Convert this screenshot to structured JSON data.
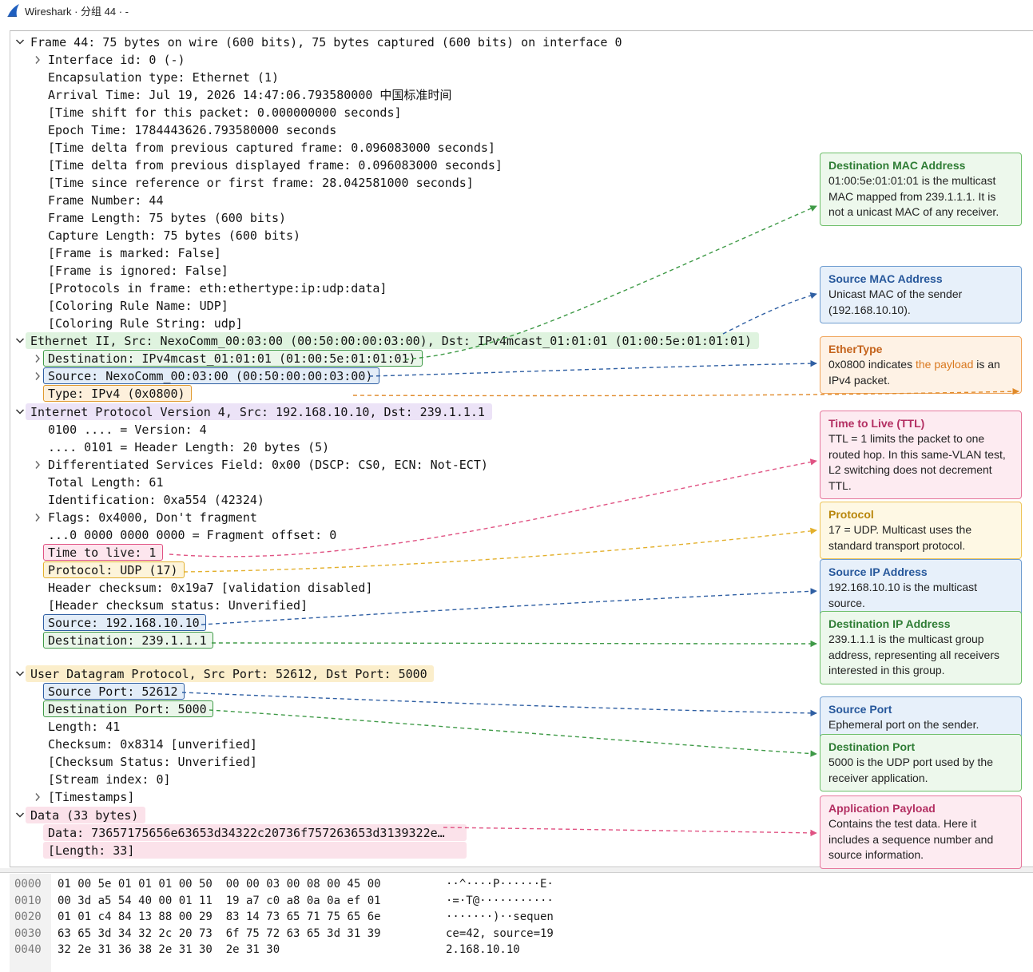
{
  "window": {
    "title": "Wireshark · 分组 44 · -",
    "icon": "wireshark-fin-icon",
    "accent": "#1f5fbf"
  },
  "tree": [
    {
      "text": "Frame 44: 75 bytes on wire (600 bits), 75 bytes captured (600 bits) on interface 0",
      "level": 0,
      "toggle": "expanded",
      "style": "none"
    },
    {
      "text": "Interface id: 0 (-)",
      "level": 1,
      "toggle": "collapsed",
      "style": "none"
    },
    {
      "text": "Encapsulation type: Ethernet (1)",
      "level": 1,
      "toggle": "none",
      "style": "none"
    },
    {
      "text": "Arrival Time: Jul 19, 2026 14:47:06.793580000 中国标准时间",
      "level": 1,
      "toggle": "none",
      "style": "none"
    },
    {
      "text": "[Time shift for this packet: 0.000000000 seconds]",
      "level": 1,
      "toggle": "none",
      "style": "none"
    },
    {
      "text": "Epoch Time: 1784443626.793580000 seconds",
      "level": 1,
      "toggle": "none",
      "style": "none"
    },
    {
      "text": "[Time delta from previous captured frame: 0.096083000 seconds]",
      "level": 1,
      "toggle": "none",
      "style": "none"
    },
    {
      "text": "[Time delta from previous displayed frame: 0.096083000 seconds]",
      "level": 1,
      "toggle": "none",
      "style": "none"
    },
    {
      "text": "[Time since reference or first frame: 28.042581000 seconds]",
      "level": 1,
      "toggle": "none",
      "style": "none"
    },
    {
      "text": "Frame Number: 44",
      "level": 1,
      "toggle": "none",
      "style": "none"
    },
    {
      "text": "Frame Length: 75 bytes (600 bits)",
      "level": 1,
      "toggle": "none",
      "style": "none"
    },
    {
      "text": "Capture Length: 75 bytes (600 bits)",
      "level": 1,
      "toggle": "none",
      "style": "none"
    },
    {
      "text": "[Frame is marked: False]",
      "level": 1,
      "toggle": "none",
      "style": "none"
    },
    {
      "text": "[Frame is ignored: False]",
      "level": 1,
      "toggle": "none",
      "style": "none"
    },
    {
      "text": "[Protocols in frame: eth:ethertype:ip:udp:data]",
      "level": 1,
      "toggle": "none",
      "style": "none"
    },
    {
      "text": "[Coloring Rule Name: UDP]",
      "level": 1,
      "toggle": "none",
      "style": "none"
    },
    {
      "text": "[Coloring Rule String: udp]",
      "level": 1,
      "toggle": "none",
      "style": "none"
    },
    {
      "text": "Ethernet II, Src: NexoComm_00:03:00 (00:50:00:00:03:00), Dst: IPv4mcast_01:01:01 (01:00:5e:01:01:01)",
      "level": 0,
      "toggle": "expanded",
      "style": "hl-green"
    },
    {
      "text": "Destination: IPv4mcast_01:01:01 (01:00:5e:01:01:01)",
      "level": 1,
      "toggle": "collapsed",
      "style": "bx-green"
    },
    {
      "text": "Source: NexoComm_00:03:00 (00:50:00:00:03:00)",
      "level": 1,
      "toggle": "collapsed",
      "style": "bx-blue"
    },
    {
      "text": "Type: IPv4 (0x0800)",
      "level": 1,
      "toggle": "none",
      "style": "bx-orange"
    },
    {
      "text": "Internet Protocol Version 4, Src: 192.168.10.10, Dst: 239.1.1.1",
      "level": 0,
      "toggle": "expanded",
      "style": "hl-purple"
    },
    {
      "text": "0100 .... = Version: 4",
      "level": 1,
      "toggle": "none",
      "style": "none"
    },
    {
      "text": ".... 0101 = Header Length: 20 bytes (5)",
      "level": 1,
      "toggle": "none",
      "style": "none"
    },
    {
      "text": "Differentiated Services Field: 0x00 (DSCP: CS0, ECN: Not-ECT)",
      "level": 1,
      "toggle": "collapsed",
      "style": "none"
    },
    {
      "text": "Total Length: 61",
      "level": 1,
      "toggle": "none",
      "style": "none"
    },
    {
      "text": "Identification: 0xa554 (42324)",
      "level": 1,
      "toggle": "none",
      "style": "none"
    },
    {
      "text": "Flags: 0x4000, Don't fragment",
      "level": 1,
      "toggle": "collapsed",
      "style": "none"
    },
    {
      "text": "...0 0000 0000 0000 = Fragment offset: 0",
      "level": 1,
      "toggle": "none",
      "style": "none"
    },
    {
      "text": "Time to live: 1",
      "level": 1,
      "toggle": "none",
      "style": "bx-pink"
    },
    {
      "text": "Protocol: UDP (17)",
      "level": 1,
      "toggle": "none",
      "style": "bx-amber"
    },
    {
      "text": "Header checksum: 0x19a7 [validation disabled]",
      "level": 1,
      "toggle": "none",
      "style": "none"
    },
    {
      "text": "[Header checksum status: Unverified]",
      "level": 1,
      "toggle": "none",
      "style": "none"
    },
    {
      "text": "Source: 192.168.10.10",
      "level": 1,
      "toggle": "none",
      "style": "bx-blue"
    },
    {
      "text": "Destination: 239.1.1.1",
      "level": 1,
      "toggle": "none",
      "style": "bx-green"
    },
    {
      "text": "User Datagram Protocol, Src Port: 52612, Dst Port: 5000",
      "level": 0,
      "toggle": "expanded",
      "style": "hl-yellow"
    },
    {
      "text": "Source Port: 52612",
      "level": 1,
      "toggle": "none",
      "style": "bx-blue"
    },
    {
      "text": "Destination Port: 5000",
      "level": 1,
      "toggle": "none",
      "style": "bx-green"
    },
    {
      "text": "Length: 41",
      "level": 1,
      "toggle": "none",
      "style": "none"
    },
    {
      "text": "Checksum: 0x8314 [unverified]",
      "level": 1,
      "toggle": "none",
      "style": "none"
    },
    {
      "text": "[Checksum Status: Unverified]",
      "level": 1,
      "toggle": "none",
      "style": "none"
    },
    {
      "text": "[Stream index: 0]",
      "level": 1,
      "toggle": "none",
      "style": "none"
    },
    {
      "text": "[Timestamps]",
      "level": 1,
      "toggle": "collapsed",
      "style": "none"
    },
    {
      "text": "Data (33 bytes)",
      "level": 0,
      "toggle": "expanded",
      "style": "hl-pink"
    },
    {
      "text": "Data: 73657175656e63653d34322c20736f757263653d3139322e…",
      "level": 1,
      "toggle": "none",
      "style": "hl-pink"
    },
    {
      "text": "[Length: 33]",
      "level": 1,
      "toggle": "none",
      "style": "hl-pink"
    }
  ],
  "annotations": [
    {
      "id": "dst-mac",
      "color": "green",
      "title": "Destination MAC Address",
      "body": "01:00:5e:01:01:01 is the multicast MAC mapped from 239.1.1.1. It is not a unicast MAC of any receiver."
    },
    {
      "id": "src-mac",
      "color": "blue",
      "title": "Source MAC Address",
      "body": "Unicast MAC of the sender (192.168.10.10)."
    },
    {
      "id": "ethertype",
      "color": "orange",
      "title": "EtherType",
      "body_before": "0x0800 indicates ",
      "body_accent": "the payload",
      "body_after": " is an IPv4 packet."
    },
    {
      "id": "ttl",
      "color": "pink",
      "title": "Time to Live (TTL)",
      "body": "TTL = 1 limits the packet to one routed hop. In this same-VLAN test, L2 switching does not decrement TTL."
    },
    {
      "id": "protocol",
      "color": "amber",
      "title": "Protocol",
      "body": "17 = UDP. Multicast uses the standard transport protocol."
    },
    {
      "id": "src-ip",
      "color": "blue",
      "title": "Source IP Address",
      "body": "192.168.10.10 is the multicast source."
    },
    {
      "id": "dst-ip",
      "color": "green",
      "title": "Destination IP Address",
      "body": "239.1.1.1 is the multicast group address, representing all receivers interested in this group."
    },
    {
      "id": "src-port",
      "color": "blue",
      "title": "Source Port",
      "body": "Ephemeral port on the sender."
    },
    {
      "id": "dst-port",
      "color": "green",
      "title": "Destination Port",
      "body": "5000 is the UDP port used by the receiver application."
    },
    {
      "id": "payload",
      "color": "pink",
      "title": "Application Payload",
      "body": "Contains the test data. Here it includes a sequence number and source information."
    }
  ],
  "colors": {
    "green": "#3f9a47",
    "blue": "#2f5fa3",
    "orange": "#e08a2a",
    "pink": "#e05383",
    "amber": "#e3b02c"
  },
  "hex": [
    {
      "offset": "0000",
      "bytes": "01 00 5e 01 01 01 00 50  00 00 03 00 08 00 45 00",
      "ascii": "··^····P······E·"
    },
    {
      "offset": "0010",
      "bytes": "00 3d a5 54 40 00 01 11  19 a7 c0 a8 0a 0a ef 01",
      "ascii": "·=·T@···········"
    },
    {
      "offset": "0020",
      "bytes": "01 01 c4 84 13 88 00 29  83 14 73 65 71 75 65 6e",
      "ascii": "·······)··sequen"
    },
    {
      "offset": "0030",
      "bytes": "63 65 3d 34 32 2c 20 73  6f 75 72 63 65 3d 31 39",
      "ascii": "ce=42, source=19"
    },
    {
      "offset": "0040",
      "bytes": "32 2e 31 36 38 2e 31 30  2e 31 30",
      "ascii": "2.168.10.10"
    }
  ]
}
